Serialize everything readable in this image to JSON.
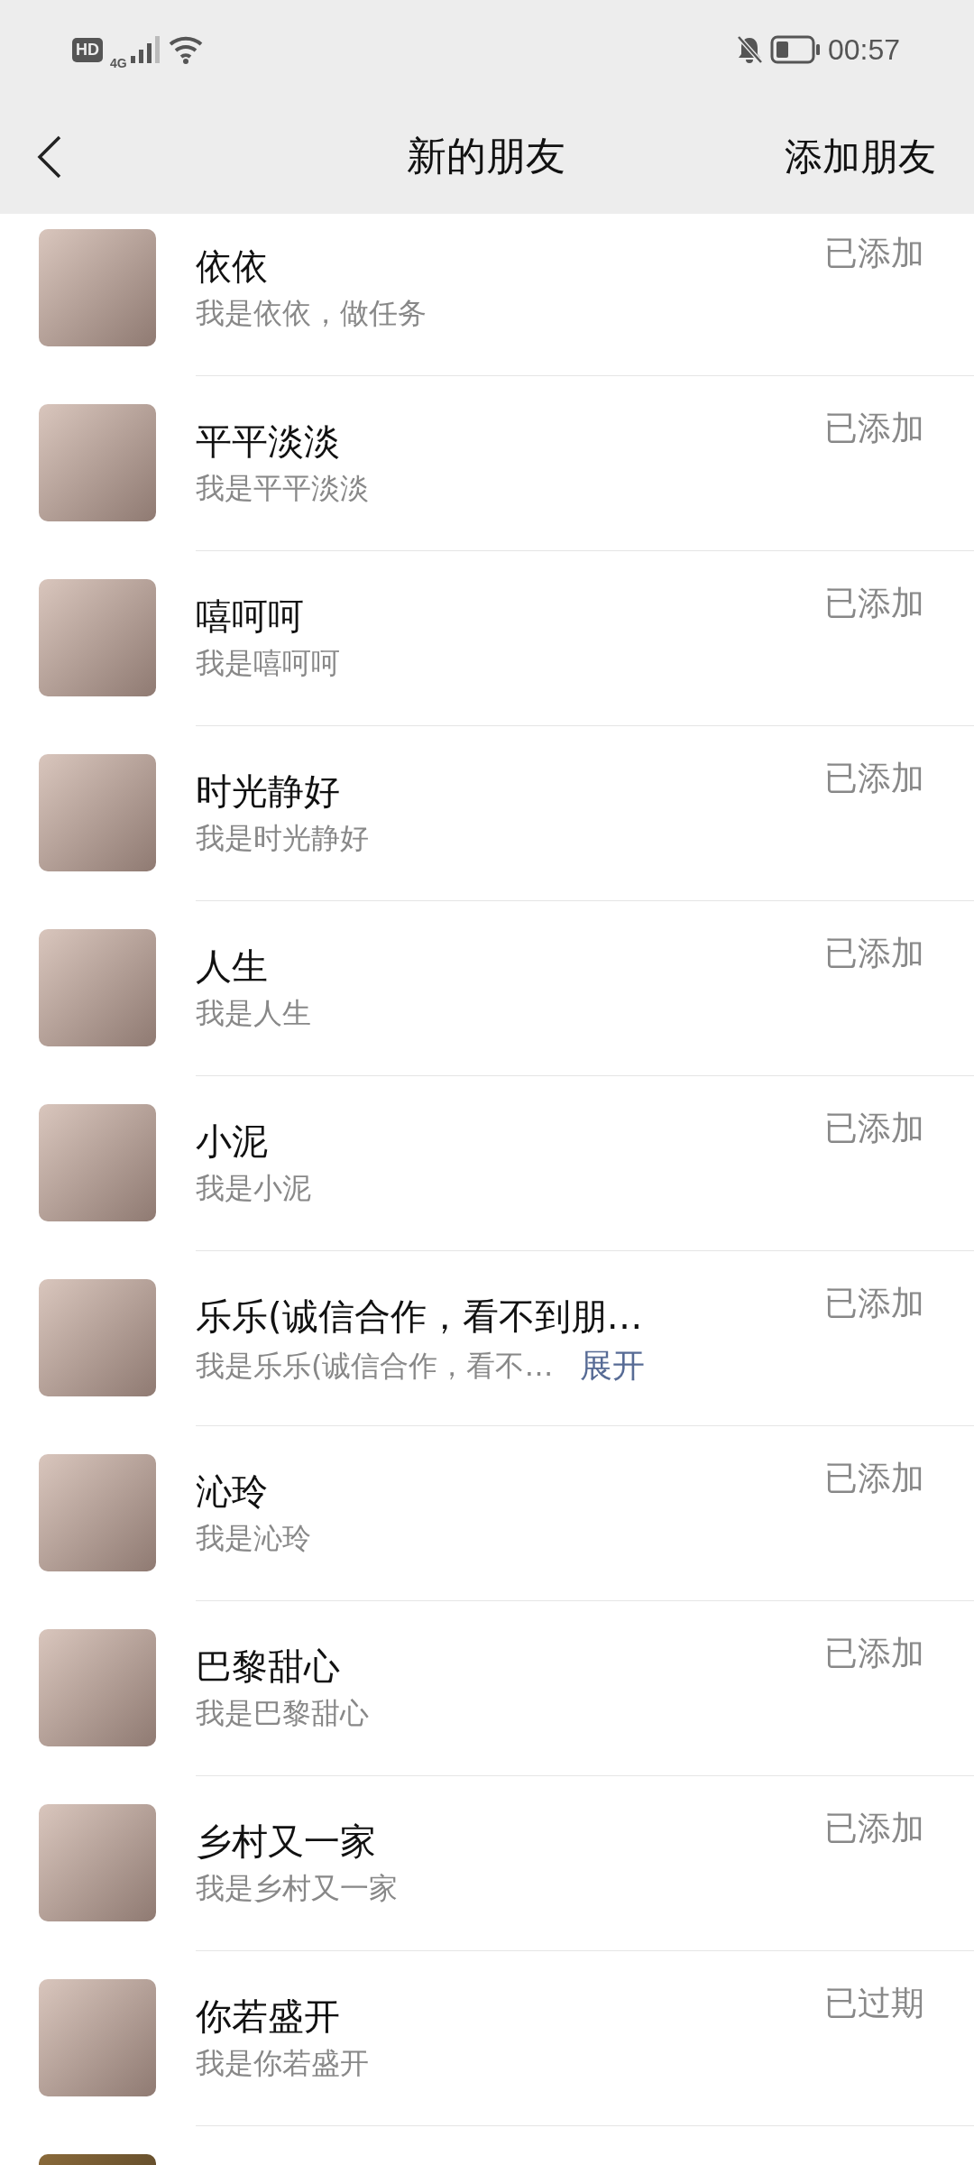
{
  "status_bar": {
    "time": "00:57",
    "hd": "HD",
    "network": "4G"
  },
  "header": {
    "title": "新的朋友",
    "action": "添加朋友"
  },
  "requests": [
    {
      "name": "依依",
      "message": "我是依依，做任务",
      "status": "已添加"
    },
    {
      "name": "平平淡淡",
      "message": "我是平平淡淡",
      "status": "已添加"
    },
    {
      "name": "嘻呵呵",
      "message": "我是嘻呵呵",
      "status": "已添加"
    },
    {
      "name": "时光静好",
      "message": "我是时光静好",
      "status": "已添加"
    },
    {
      "name": "人生",
      "message": "我是人生",
      "status": "已添加"
    },
    {
      "name": "小泥",
      "message": "我是小泥",
      "status": "已添加"
    },
    {
      "name": "乐乐(诚信合作，看不到朋…",
      "message": "我是乐乐(诚信合作，看不…",
      "status": "已添加",
      "expand_link": "展开"
    },
    {
      "name": "沁玲",
      "message": "我是沁玲",
      "status": "已添加"
    },
    {
      "name": "巴黎甜心",
      "message": "我是巴黎甜心",
      "status": "已添加"
    },
    {
      "name": "乡村又一家",
      "message": "我是乡村又一家",
      "status": "已添加"
    },
    {
      "name": "你若盛开",
      "message": "我是你若盛开",
      "status": "已过期"
    }
  ],
  "more_below": true
}
